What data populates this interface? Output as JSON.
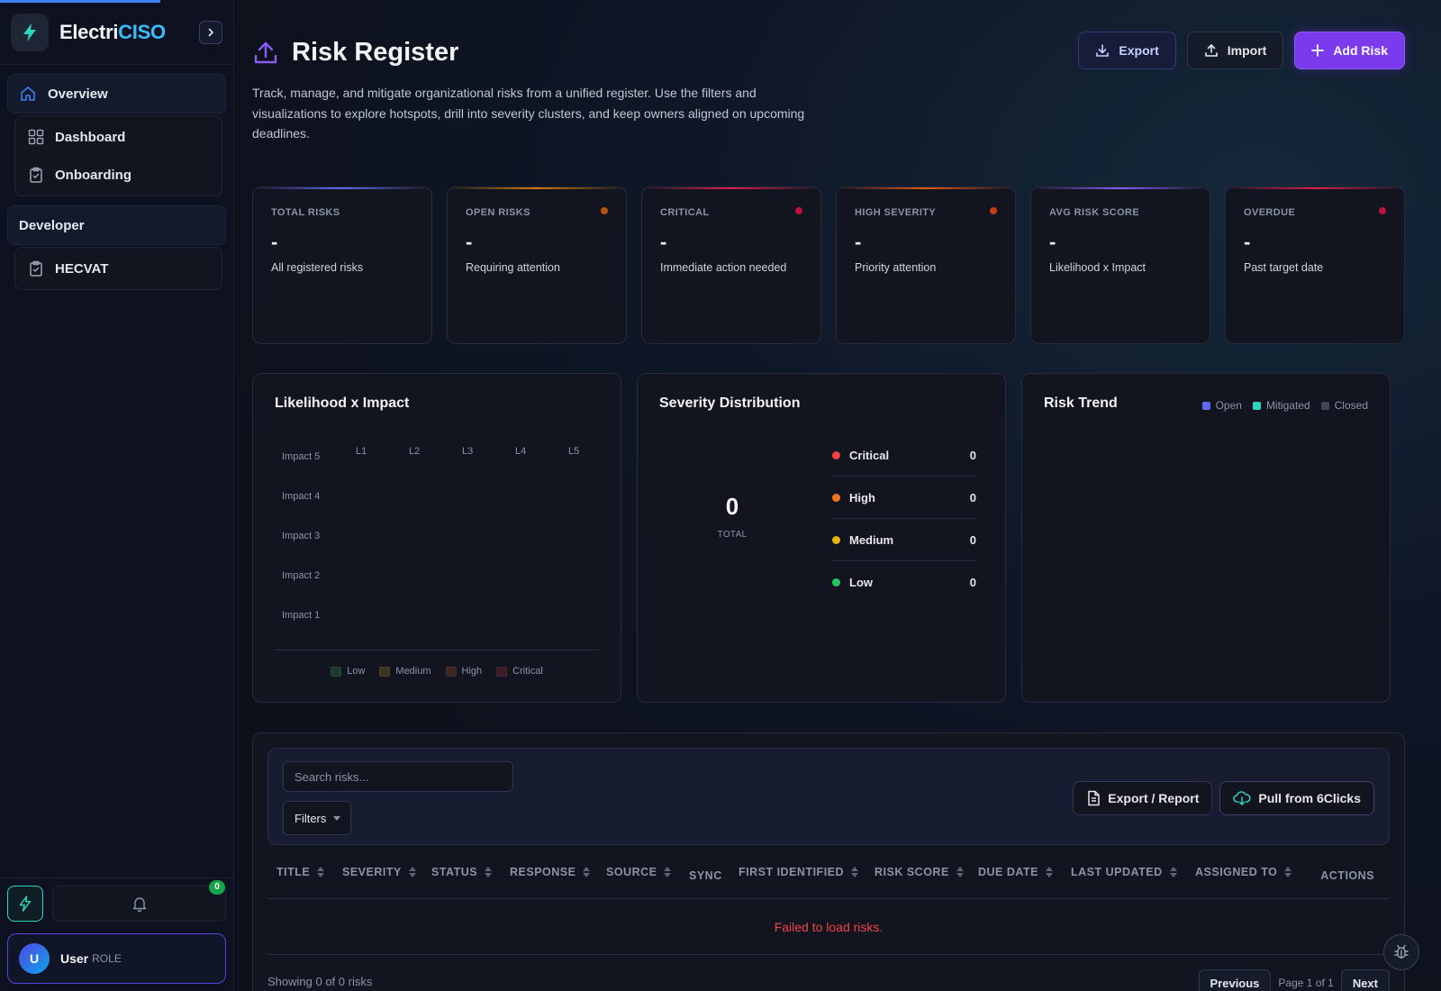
{
  "app": {
    "brand_part1": "Electri",
    "brand_part2": "CISO",
    "accent": "#7c3aed",
    "brand_color": "#38bdf8"
  },
  "sidebar": {
    "groups": [
      {
        "label": "Overview",
        "icon": "home-icon",
        "items": [
          {
            "label": "Dashboard",
            "icon": "grid-icon"
          },
          {
            "label": "Onboarding",
            "icon": "clipboard-check-icon"
          }
        ]
      },
      {
        "label": "Developer",
        "items": [
          {
            "label": "HECVAT",
            "icon": "clipboard-check-icon"
          }
        ]
      }
    ],
    "notification_count": "0",
    "user": {
      "initial": "U",
      "name": "User",
      "role": "ROLE"
    }
  },
  "header": {
    "title": "Risk Register",
    "icon": "upload-icon",
    "description": "Track, manage, and mitigate organizational risks from a unified register. Use the filters and visualizations to explore hotspots, drill into severity clusters, and keep owners aligned on upcoming deadlines.",
    "actions": {
      "export": "Export",
      "import": "Import",
      "add": "Add Risk"
    }
  },
  "stats": [
    {
      "label": "TOTAL RISKS",
      "value": "-",
      "desc": "All registered risks",
      "color": "#6366f1"
    },
    {
      "label": "OPEN RISKS",
      "value": "-",
      "desc": "Requiring attention",
      "color": "#d97706"
    },
    {
      "label": "CRITICAL",
      "value": "-",
      "desc": "Immediate action needed",
      "color": "#e11d48"
    },
    {
      "label": "HIGH SEVERITY",
      "value": "-",
      "desc": "Priority attention",
      "color": "#ea580c"
    },
    {
      "label": "AVG RISK SCORE",
      "value": "-",
      "desc": "Likelihood x Impact",
      "color": "#8b5cf6"
    },
    {
      "label": "OVERDUE",
      "value": "-",
      "desc": "Past target date",
      "color": "#e11d48"
    }
  ],
  "matrix": {
    "title": "Likelihood x Impact",
    "impacts": [
      "Impact 5",
      "Impact 4",
      "Impact 3",
      "Impact 2",
      "Impact 1"
    ],
    "likelihoods": [
      "L1",
      "L2",
      "L3",
      "L4",
      "L5"
    ],
    "legend": [
      {
        "label": "Low",
        "color": "#1f3a2c"
      },
      {
        "label": "Medium",
        "color": "#3d3520"
      },
      {
        "label": "High",
        "color": "#3d2622"
      },
      {
        "label": "Critical",
        "color": "#3b1d28"
      }
    ]
  },
  "severity": {
    "title": "Severity Distribution",
    "total": "0",
    "total_label": "TOTAL",
    "rows": [
      {
        "label": "Critical",
        "count": "0",
        "color": "#ef4444"
      },
      {
        "label": "High",
        "count": "0",
        "color": "#f97316"
      },
      {
        "label": "Medium",
        "count": "0",
        "color": "#eab308"
      },
      {
        "label": "Low",
        "count": "0",
        "color": "#22c55e"
      }
    ]
  },
  "trend": {
    "title": "Risk Trend",
    "legend": [
      {
        "label": "Open",
        "color": "#6366f1"
      },
      {
        "label": "Mitigated",
        "color": "#2dd4bf"
      },
      {
        "label": "Closed",
        "color": "#3f4658"
      }
    ]
  },
  "table": {
    "search_placeholder": "Search risks...",
    "filters_label": "Filters",
    "export_report": "Export / Report",
    "pull": "Pull from 6Clicks",
    "columns": [
      {
        "label": "TITLE",
        "sortable": true
      },
      {
        "label": "SEVERITY",
        "sortable": true
      },
      {
        "label": "STATUS",
        "sortable": true
      },
      {
        "label": "RESPONSE",
        "sortable": true
      },
      {
        "label": "SOURCE",
        "sortable": true
      },
      {
        "label": "SYNC",
        "sortable": false
      },
      {
        "label": "FIRST IDENTIFIED",
        "sortable": true
      },
      {
        "label": "RISK SCORE",
        "sortable": true
      },
      {
        "label": "DUE DATE",
        "sortable": true
      },
      {
        "label": "LAST UPDATED",
        "sortable": true
      },
      {
        "label": "ASSIGNED TO",
        "sortable": true
      },
      {
        "label": "ACTIONS",
        "sortable": false
      }
    ],
    "empty_message": "Failed to load risks.",
    "showing": "Showing 0 of 0 risks",
    "previous": "Previous",
    "page_info": "Page 1 of 1",
    "next": "Next"
  }
}
